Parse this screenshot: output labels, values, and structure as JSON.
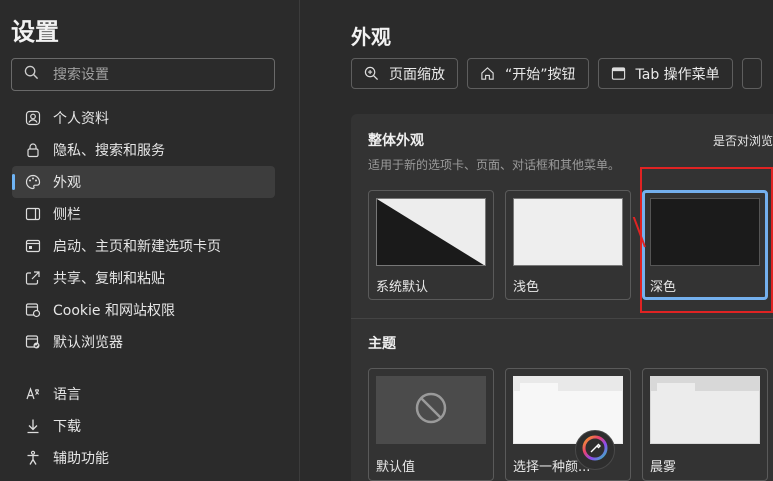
{
  "sidebar": {
    "title": "设置",
    "search_placeholder": "搜索设置",
    "items": [
      {
        "label": "个人资料",
        "icon": "profile-icon"
      },
      {
        "label": "隐私、搜索和服务",
        "icon": "lock-icon"
      },
      {
        "label": "外观",
        "icon": "palette-icon",
        "active": true
      },
      {
        "label": "侧栏",
        "icon": "sidebar-icon"
      },
      {
        "label": "启动、主页和新建选项卡页",
        "icon": "window-icon"
      },
      {
        "label": "共享、复制和粘贴",
        "icon": "share-icon"
      },
      {
        "label": "Cookie 和网站权限",
        "icon": "site-permissions-icon"
      },
      {
        "label": "默认浏览器",
        "icon": "browser-icon"
      },
      {
        "label": "语言",
        "icon": "language-icon"
      },
      {
        "label": "下载",
        "icon": "download-icon"
      },
      {
        "label": "辅助功能",
        "icon": "accessibility-icon"
      }
    ]
  },
  "main": {
    "title": "外观",
    "chips": [
      {
        "label": "页面缩放",
        "icon": "zoom-icon"
      },
      {
        "label": "“开始”按钮",
        "icon": "home-icon"
      },
      {
        "label": "Tab 操作菜单",
        "icon": "tab-menu-icon"
      }
    ],
    "overall": {
      "title": "整体外观",
      "desc": "适用于新的选项卡、页面、对话框和其他菜单。",
      "right_text": "是否对浏览",
      "options": [
        {
          "label": "系统默认"
        },
        {
          "label": "浅色"
        },
        {
          "label": "深色",
          "selected": true
        }
      ]
    },
    "theme": {
      "title": "主题",
      "options": [
        {
          "label": "默认值"
        },
        {
          "label": "选择一种颜..."
        },
        {
          "label": "晨雾"
        }
      ]
    }
  },
  "colors": {
    "accent": "#74b0ee",
    "annotation_red": "#e02323",
    "background": "#2b2b2b",
    "panel": "#333333"
  }
}
